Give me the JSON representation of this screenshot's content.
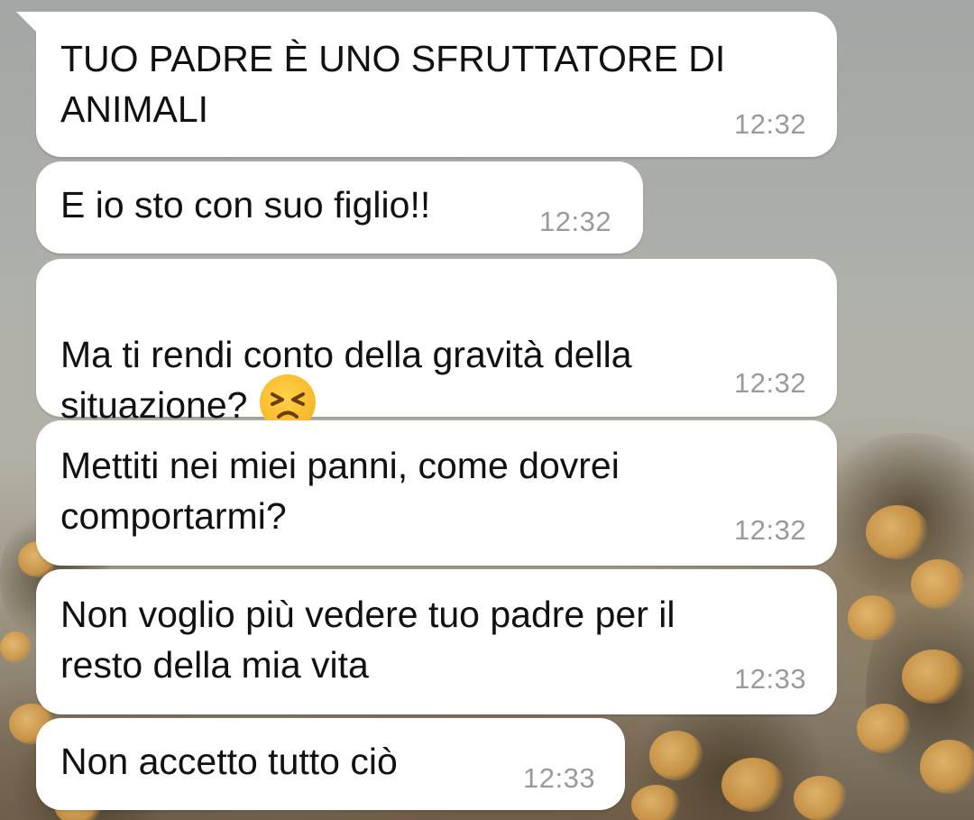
{
  "messages": [
    {
      "text": "TUO PADRE È UNO SFRUTTATORE DI\nANIMALI",
      "time": "12:32"
    },
    {
      "text": "E io sto con suo figlio!!",
      "time": "12:32"
    },
    {
      "text": "Ma ti rendi conto della gravità della\nsituazione?",
      "emoji": "persevering-face-icon",
      "time": "12:32"
    },
    {
      "text": "Mettiti nei miei panni, come dovrei\ncomportarmi?",
      "time": "12:32"
    },
    {
      "text": "Non voglio più vedere tuo padre per il\nresto della mia vita",
      "time": "12:33"
    },
    {
      "text": "Non accetto tutto ciò",
      "time": "12:33"
    }
  ],
  "colors": {
    "bubble": "#ffffff",
    "text": "#111111",
    "timestamp": "#9a9a9a"
  }
}
